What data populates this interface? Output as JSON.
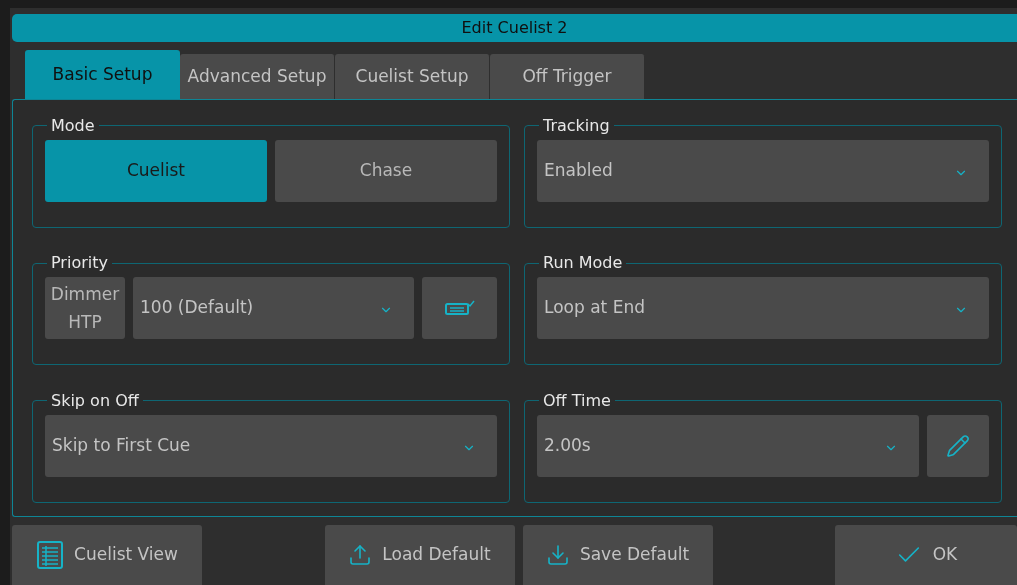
{
  "window": {
    "title": "Edit Cuelist 2"
  },
  "tabs": [
    {
      "label": "Basic Setup",
      "selected": true
    },
    {
      "label": "Advanced Setup",
      "selected": false
    },
    {
      "label": "Cuelist Setup",
      "selected": false
    },
    {
      "label": "Off Trigger",
      "selected": false
    }
  ],
  "groups": [
    {
      "label": "Mode",
      "controls": [
        {
          "kind": "toggle",
          "label": "Cuelist",
          "selected": true
        },
        {
          "kind": "toggle",
          "label": "Chase",
          "selected": false
        }
      ]
    },
    {
      "label": "Tracking",
      "controls": [
        {
          "kind": "dropdown",
          "value": "Enabled"
        }
      ]
    },
    {
      "label": "Priority",
      "controls": [
        {
          "kind": "button",
          "label": "Dimmer HTP"
        },
        {
          "kind": "dropdown",
          "value": "100 (Default)"
        },
        {
          "kind": "keypad_button"
        }
      ]
    },
    {
      "label": "Run Mode",
      "controls": [
        {
          "kind": "dropdown",
          "value": "Loop at End"
        }
      ]
    },
    {
      "label": "Skip on Off",
      "controls": [
        {
          "kind": "dropdown",
          "value": "Skip to First Cue"
        }
      ]
    },
    {
      "label": "Off Time",
      "controls": [
        {
          "kind": "dropdown",
          "value": "2.00s"
        },
        {
          "kind": "edit_button"
        }
      ]
    }
  ],
  "footer_buttons": [
    {
      "kind": "list",
      "label": "Cuelist View"
    },
    {
      "kind": "upload",
      "label": "Load Default"
    },
    {
      "kind": "download",
      "label": "Save Default"
    },
    {
      "kind": "check",
      "label": "OK"
    }
  ]
}
